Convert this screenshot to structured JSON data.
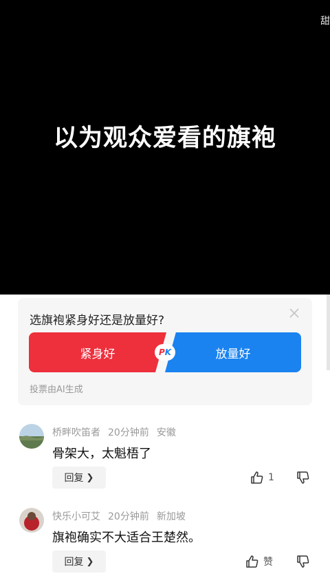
{
  "video": {
    "caption": "以为观众爱看的旗袍",
    "corner_text": "甜"
  },
  "poll": {
    "question": "选旗袍紧身好还是放量好?",
    "option_left": "紧身好",
    "option_right": "放量好",
    "pk_p": "P",
    "pk_k": "K",
    "footer": "投票由AI生成",
    "colors": {
      "left": "#ee2f3c",
      "right": "#1a83f0"
    }
  },
  "comments": [
    {
      "username": "桥畔吹笛者",
      "time": "20分钟前",
      "location": "安徽",
      "text": "骨架大，太魁梧了",
      "reply_label": "回复",
      "like_count": "1"
    },
    {
      "username": "快乐小可艾",
      "time": "20分钟前",
      "location": "新加坡",
      "text": "旗袍确实不大适合王楚然。",
      "reply_label": "回复",
      "like_count": "赞"
    }
  ],
  "icons": {
    "close": "close-icon",
    "like": "thumbs-up-icon",
    "dislike": "thumbs-down-icon",
    "chevron": "chevron-right-icon"
  }
}
